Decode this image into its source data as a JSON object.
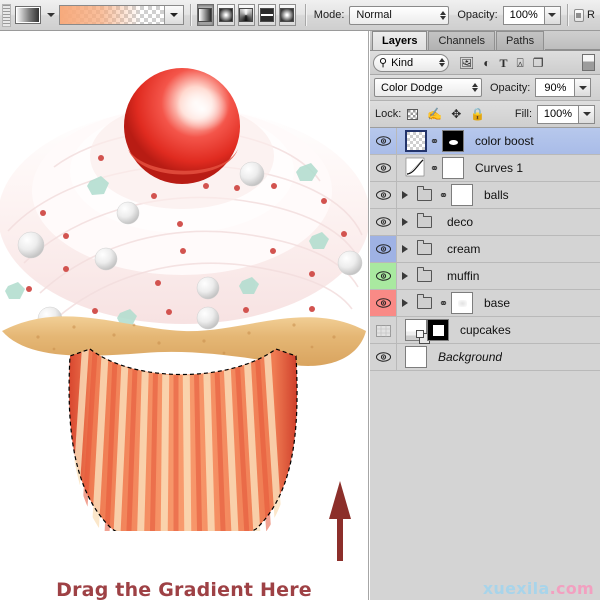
{
  "app": "Adobe Photoshop — Gradient Tool options and Layers panel",
  "options_bar": {
    "gradient_picker": {
      "name": "gradient-preset-picker",
      "preset_label": "Foreground to Transparent"
    },
    "gradient_types": [
      {
        "name": "linear-gradient",
        "label": "Linear Gradient",
        "active": true
      },
      {
        "name": "radial-gradient",
        "label": "Radial Gradient",
        "active": false
      },
      {
        "name": "angle-gradient",
        "label": "Angle Gradient",
        "active": false
      },
      {
        "name": "reflected-gradient",
        "label": "Reflected Gradient",
        "active": false
      },
      {
        "name": "diamond-gradient",
        "label": "Diamond Gradient",
        "active": false
      }
    ],
    "mode_label": "Mode:",
    "mode_value": "Normal",
    "opacity_label": "Opacity:",
    "opacity_value": "100%",
    "reverse_label": "R"
  },
  "canvas": {
    "annotation_text": "Drag the Gradient Here",
    "annotation_color": "#9e4145",
    "arrow_color": "#8c2f2a",
    "selection": "marching-ants around cupcake wrapper"
  },
  "panel": {
    "tabs": [
      {
        "label": "Layers",
        "active": true
      },
      {
        "label": "Channels",
        "active": false
      },
      {
        "label": "Paths",
        "active": false
      }
    ],
    "filter": {
      "kind_label": "Kind",
      "icons": [
        "pixel-filter-icon",
        "adjustment-filter-icon",
        "type-filter-icon",
        "shape-filter-icon",
        "smart-object-filter-icon",
        "filter-toggle-icon"
      ]
    },
    "blend": {
      "mode_value": "Color Dodge",
      "opacity_label": "Opacity:",
      "opacity_value": "90%"
    },
    "lock": {
      "label": "Lock:",
      "icons": [
        "lock-transparent-pixels-icon",
        "lock-image-pixels-icon",
        "lock-position-icon",
        "lock-all-icon"
      ],
      "fill_label": "Fill:",
      "fill_value": "100%"
    },
    "layers": [
      {
        "name": "color boost",
        "visible": true,
        "selected": true,
        "group": false,
        "expand_arrow": false,
        "thumb": "checker",
        "thumb_selected": true,
        "link": true,
        "mask": "mask-blob",
        "color_tag": "none",
        "italic": false
      },
      {
        "name": "Curves 1",
        "visible": true,
        "selected": false,
        "group": false,
        "expand_arrow": false,
        "thumb": "curves",
        "thumb_selected": false,
        "link": true,
        "mask": "mask-white",
        "color_tag": "none",
        "italic": false
      },
      {
        "name": "balls",
        "visible": true,
        "selected": false,
        "group": true,
        "expand_arrow": true,
        "thumb": "none",
        "thumb_selected": false,
        "link": true,
        "mask": "mask-white",
        "color_tag": "none",
        "italic": false
      },
      {
        "name": "deco",
        "visible": true,
        "selected": false,
        "group": true,
        "expand_arrow": true,
        "thumb": "none",
        "thumb_selected": false,
        "link": false,
        "mask": "none",
        "color_tag": "none",
        "italic": false
      },
      {
        "name": "cream",
        "visible": true,
        "selected": false,
        "group": true,
        "expand_arrow": true,
        "thumb": "none",
        "thumb_selected": false,
        "link": false,
        "mask": "none",
        "color_tag": "#9fb2e4",
        "italic": false
      },
      {
        "name": "muffin",
        "visible": true,
        "selected": false,
        "group": true,
        "expand_arrow": true,
        "thumb": "none",
        "thumb_selected": false,
        "link": false,
        "mask": "none",
        "color_tag": "#a9e9a0",
        "italic": false
      },
      {
        "name": "base",
        "visible": true,
        "selected": false,
        "group": true,
        "expand_arrow": true,
        "thumb": "none",
        "thumb_selected": false,
        "link": true,
        "mask": "faint",
        "color_tag": "#f98a86",
        "italic": false
      },
      {
        "name": "cupcakes",
        "visible": false,
        "selected": false,
        "group": false,
        "expand_arrow": false,
        "thumb": "smart",
        "thumb_selected": false,
        "link": false,
        "mask": "mask-sq",
        "color_tag": "none",
        "italic": false
      },
      {
        "name": "Background",
        "visible": true,
        "selected": false,
        "group": false,
        "expand_arrow": false,
        "thumb": "mask-white",
        "thumb_selected": false,
        "link": false,
        "mask": "none",
        "color_tag": "none",
        "italic": true
      }
    ]
  },
  "watermark": {
    "part_a": "xuexila",
    "part_b": ".com",
    "color_a": "#a8d4ea",
    "color_b": "#f2a0c0"
  }
}
